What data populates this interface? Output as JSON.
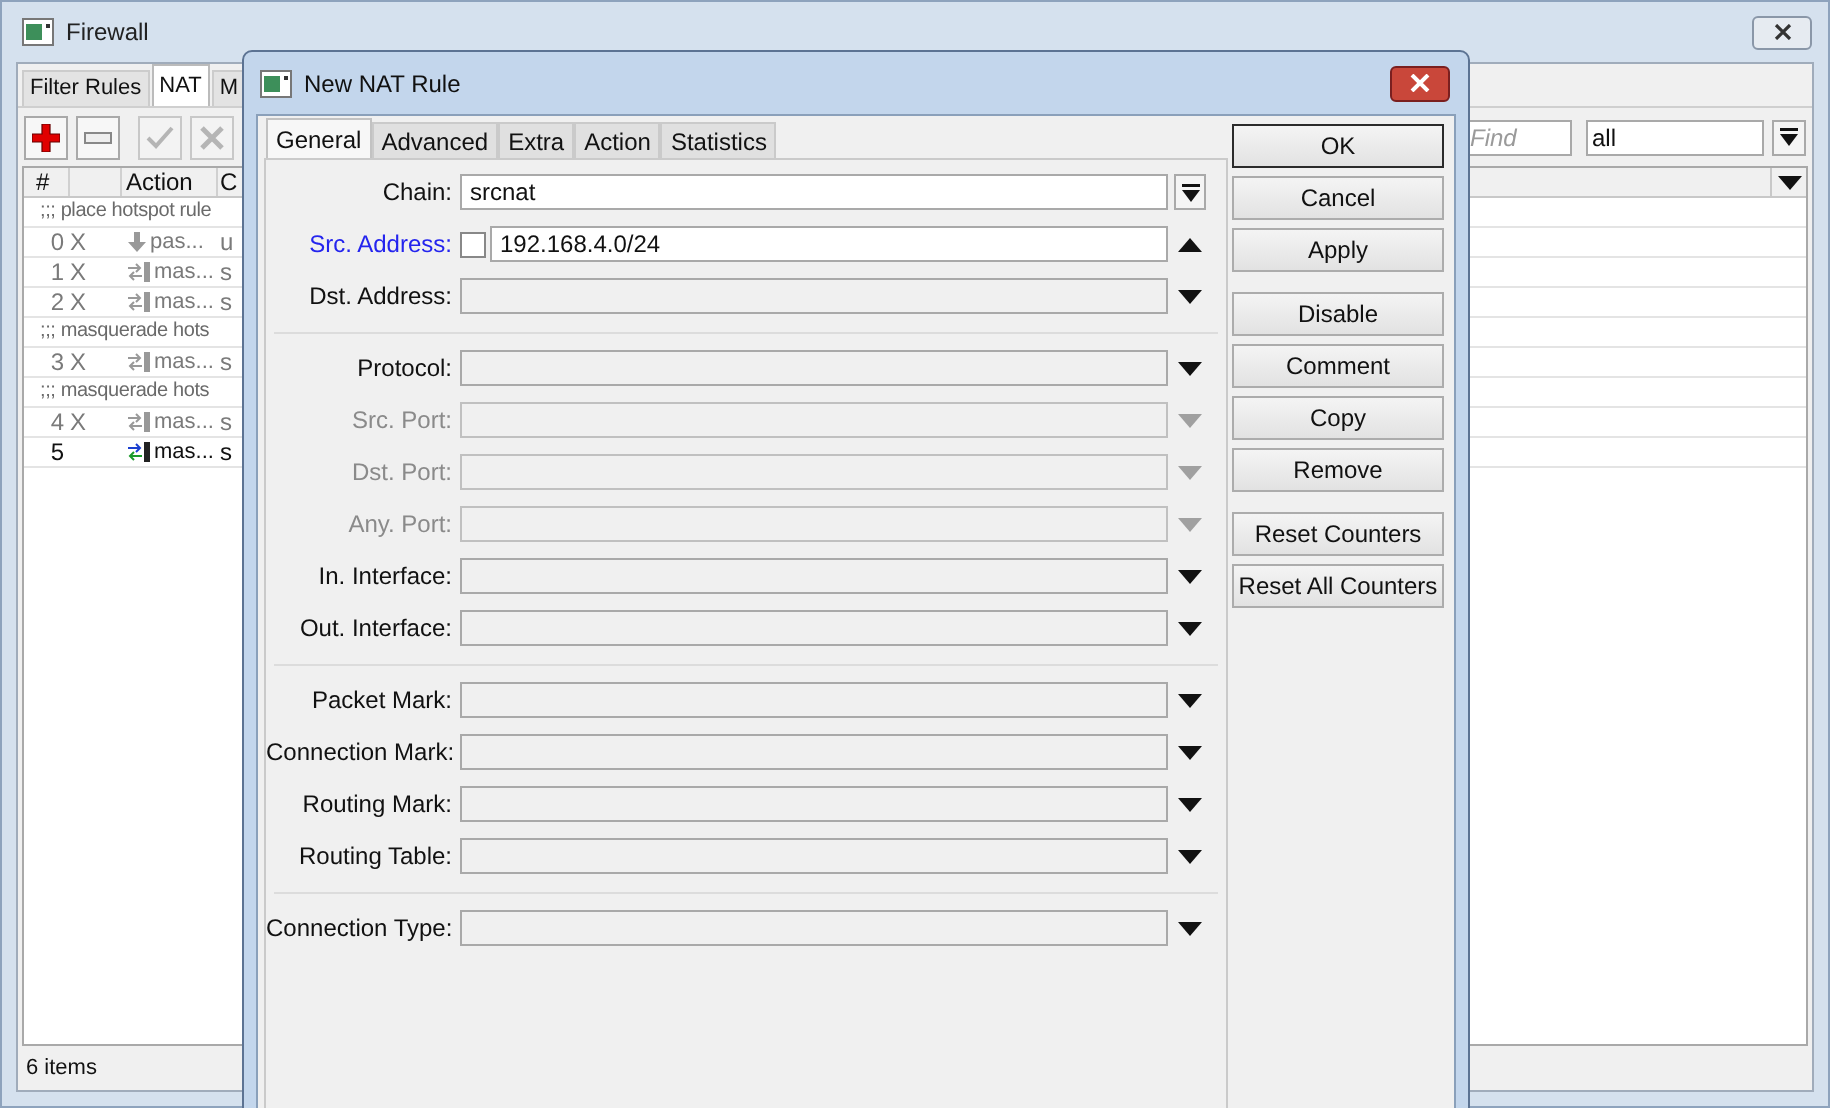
{
  "firewall": {
    "title": "Firewall",
    "tabs": [
      {
        "label": "Filter Rules",
        "selected": false
      },
      {
        "label": "NAT",
        "selected": true
      },
      {
        "label": "M",
        "selected": false
      }
    ],
    "toolbar": [
      {
        "kind": "add",
        "disabled": false
      },
      {
        "kind": "remove",
        "disabled": false
      },
      {
        "kind": "enable",
        "disabled": true
      },
      {
        "kind": "disable",
        "disabled": true
      }
    ],
    "find": {
      "placeholder": "Find"
    },
    "filter": {
      "value": "all"
    },
    "table": {
      "columns": {
        "number": "#",
        "action": "Action",
        "column_4": "C"
      },
      "rows": [
        {
          "kind": "comment",
          "text": ";;; place hotspot rule"
        },
        {
          "kind": "rule",
          "number": "0",
          "flag": "X",
          "action": {
            "text": "pas...",
            "kind": "passthrough"
          },
          "column_4": "u",
          "disabled": true
        },
        {
          "kind": "rule",
          "number": "1",
          "flag": "X",
          "action": {
            "text": "mas...",
            "kind": "masquerade"
          },
          "column_4": "s",
          "disabled": true
        },
        {
          "kind": "rule",
          "number": "2",
          "flag": "X",
          "action": {
            "text": "mas...",
            "kind": "masquerade"
          },
          "column_4": "s",
          "disabled": true
        },
        {
          "kind": "comment",
          "text": ";;; masquerade hots"
        },
        {
          "kind": "rule",
          "number": "3",
          "flag": "X",
          "action": {
            "text": "mas...",
            "kind": "masquerade"
          },
          "column_4": "s",
          "disabled": true
        },
        {
          "kind": "comment",
          "text": ";;; masquerade hots"
        },
        {
          "kind": "rule",
          "number": "4",
          "flag": "X",
          "action": {
            "text": "mas...",
            "kind": "masquerade"
          },
          "column_4": "s",
          "disabled": true
        },
        {
          "kind": "rule",
          "number": "5",
          "action": {
            "text": "mas...",
            "kind": "masquerade"
          },
          "column_4": "s",
          "disabled": false
        }
      ]
    },
    "status_bar": "6 items"
  },
  "dialog": {
    "title": "New NAT Rule",
    "tabs": [
      {
        "label": "General",
        "selected": true
      },
      {
        "label": "Advanced",
        "selected": false
      },
      {
        "label": "Extra",
        "selected": false
      },
      {
        "label": "Action",
        "selected": false
      },
      {
        "label": "Statistics",
        "selected": false
      }
    ],
    "field_groups": [
      [
        {
          "label": "Chain:",
          "kind": "select",
          "value": "srcnat",
          "disabled": false,
          "highlighted": false
        },
        {
          "label": "Src. Address:",
          "kind": "entry",
          "value": "192.168.4.0/24",
          "disabled": false,
          "highlighted": true,
          "expanded": true,
          "negated": false
        },
        {
          "label": "Dst. Address:",
          "kind": "entry",
          "disabled": false,
          "highlighted": false,
          "expanded": false
        }
      ],
      [
        {
          "label": "Protocol:",
          "kind": "entry",
          "disabled": false,
          "highlighted": false,
          "expanded": false
        },
        {
          "label": "Src. Port:",
          "kind": "entry",
          "disabled": true,
          "highlighted": false,
          "expanded": false
        },
        {
          "label": "Dst. Port:",
          "kind": "entry",
          "disabled": true,
          "highlighted": false,
          "expanded": false
        },
        {
          "label": "Any. Port:",
          "kind": "entry",
          "disabled": true,
          "highlighted": false,
          "expanded": false
        },
        {
          "label": "In. Interface:",
          "kind": "entry",
          "disabled": false,
          "highlighted": false,
          "expanded": false
        },
        {
          "label": "Out. Interface:",
          "kind": "entry",
          "disabled": false,
          "highlighted": false,
          "expanded": false
        }
      ],
      [
        {
          "label": "Packet Mark:",
          "kind": "entry",
          "disabled": false,
          "highlighted": false,
          "expanded": false
        },
        {
          "label": "Connection Mark:",
          "kind": "entry",
          "disabled": false,
          "highlighted": false,
          "expanded": false
        },
        {
          "label": "Routing Mark:",
          "kind": "entry",
          "disabled": false,
          "highlighted": false,
          "expanded": false
        },
        {
          "label": "Routing Table:",
          "kind": "entry",
          "disabled": false,
          "highlighted": false,
          "expanded": false
        }
      ],
      [
        {
          "label": "Connection Type:",
          "kind": "entry",
          "disabled": false,
          "highlighted": false,
          "expanded": false
        }
      ]
    ],
    "button_groups": [
      [
        {
          "label": "OK",
          "default": true
        },
        {
          "label": "Cancel",
          "default": false
        },
        {
          "label": "Apply",
          "default": false
        }
      ],
      [
        {
          "label": "Disable",
          "default": false
        },
        {
          "label": "Comment",
          "default": false
        },
        {
          "label": "Copy",
          "default": false
        },
        {
          "label": "Remove",
          "default": false
        }
      ],
      [
        {
          "label": "Reset Counters",
          "default": false
        },
        {
          "label": "Reset All Counters",
          "default": false
        }
      ]
    ]
  }
}
